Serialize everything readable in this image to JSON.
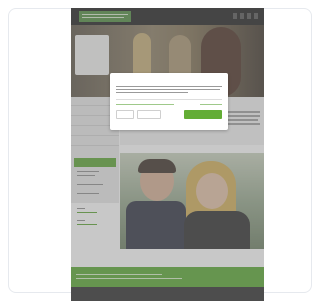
{
  "page": {
    "nav": [
      {
        "label": ""
      },
      {
        "label": ""
      },
      {
        "label": ""
      },
      {
        "label": ""
      }
    ],
    "sidebar_items": [
      {
        "label": ""
      },
      {
        "label": ""
      },
      {
        "label": ""
      },
      {
        "label": ""
      },
      {
        "label": ""
      }
    ],
    "contact_label": "",
    "main_heading": "",
    "photo_caption": "",
    "footer_links": [
      {
        "label": ""
      },
      {
        "label": ""
      },
      {
        "label": ""
      },
      {
        "label": ""
      }
    ]
  },
  "cookie_dialog": {
    "title": "",
    "toggle_label": "",
    "buttons": [
      {
        "label": ""
      },
      {
        "label": ""
      },
      {
        "label": ""
      }
    ]
  },
  "colors": {
    "accent": "#5aa431",
    "overlay": "#7d7d7d",
    "footer": "#2b2b2b"
  }
}
